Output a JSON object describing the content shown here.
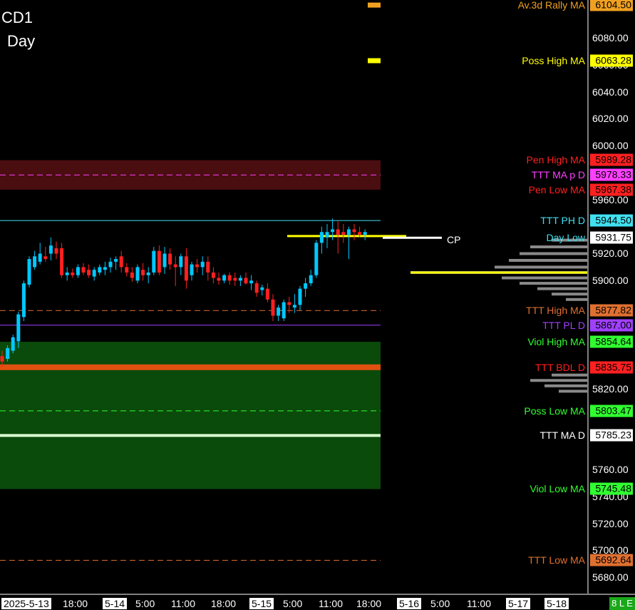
{
  "header": {
    "symbol": "CD1",
    "period": "Day"
  },
  "status_badge": "8 L E",
  "cp_label": "CP",
  "chart_data": {
    "type": "candlestick",
    "ylim": [
      5668,
      6108
    ],
    "y_ticks": [
      {
        "value": 6080,
        "label": "6080.00"
      },
      {
        "value": 6060,
        "label": "6060.00"
      },
      {
        "value": 6040,
        "label": "6040.00"
      },
      {
        "value": 6020,
        "label": "6020.00"
      },
      {
        "value": 6000,
        "label": "6000.00"
      },
      {
        "value": 5960,
        "label": "5960.00"
      },
      {
        "value": 5920,
        "label": "5920.00"
      },
      {
        "value": 5900,
        "label": "5900.00"
      },
      {
        "value": 5820,
        "label": "5820.00"
      },
      {
        "value": 5760,
        "label": "5760.00"
      },
      {
        "value": 5740,
        "label": "5740.00"
      },
      {
        "value": 5720,
        "label": "5720.00"
      },
      {
        "value": 5700,
        "label": "5700.00"
      },
      {
        "value": 5680,
        "label": "5680.00"
      }
    ],
    "x_ticks": [
      {
        "label": "2025-5-13",
        "boxed": true
      },
      {
        "label": "18:00",
        "boxed": false
      },
      {
        "label": "5-14",
        "boxed": true
      },
      {
        "label": "5:00",
        "boxed": false
      },
      {
        "label": "11:00",
        "boxed": false
      },
      {
        "label": "18:00",
        "boxed": false
      },
      {
        "label": "5-15",
        "boxed": true
      },
      {
        "label": "5:00",
        "boxed": false
      },
      {
        "label": "11:00",
        "boxed": false
      },
      {
        "label": "18:00",
        "boxed": false
      },
      {
        "label": "5-16",
        "boxed": true
      },
      {
        "label": "5:00",
        "boxed": false
      },
      {
        "label": "11:00",
        "boxed": false
      },
      {
        "label": "5-17",
        "boxed": true
      },
      {
        "label": "5-18",
        "boxed": true
      }
    ],
    "zones": [
      {
        "from": 5967.38,
        "to": 5989.28,
        "color": "#4a0d10"
      },
      {
        "from": 5745.48,
        "to": 5854.64,
        "color": "#0a4a0a"
      }
    ],
    "levels": [
      {
        "label": "Av.3d Rally MA",
        "price": "6104.50",
        "value": 6104.5,
        "color": "#f0a020",
        "bg": "#f0a020",
        "fg": "#000",
        "line": "marker"
      },
      {
        "label": "Poss High MA",
        "price": "6063.28",
        "value": 6063.28,
        "color": "#ffff00",
        "bg": "#ffff00",
        "fg": "#000",
        "line": "marker"
      },
      {
        "label": "Pen High MA",
        "price": "5989.28",
        "value": 5989.28,
        "color": "#ff2020",
        "bg": "#ff2020",
        "fg": "#000",
        "line": "none"
      },
      {
        "label": "TTT MA p D",
        "price": "5978.33",
        "value": 5978.33,
        "color": "#ff40ff",
        "bg": "#ff40ff",
        "fg": "#000",
        "line": "dash"
      },
      {
        "label": "Pen Low MA",
        "price": "5967.38",
        "value": 5967.38,
        "color": "#ff2020",
        "bg": "#ff2020",
        "fg": "#000",
        "line": "none"
      },
      {
        "label": "TTT PH D",
        "price": "5944.50",
        "value": 5944.5,
        "color": "#40e0f0",
        "bg": "#40e0f0",
        "fg": "#000",
        "line": "solid"
      },
      {
        "label": "Day Low",
        "price": "5931.75",
        "value": 5931.75,
        "color": "#40e0f0",
        "bg": "#ffffff",
        "fg": "#000",
        "line": "none"
      },
      {
        "label": "TTT High MA",
        "price": "5877.82",
        "value": 5877.82,
        "color": "#e07030",
        "bg": "#e07030",
        "fg": "#000",
        "line": "dash"
      },
      {
        "label": "TTT PL D",
        "price": "5867.00",
        "value": 5867.0,
        "color": "#a040ff",
        "bg": "#a040ff",
        "fg": "#000",
        "line": "solid"
      },
      {
        "label": "Viol High MA",
        "price": "5854.64",
        "value": 5854.64,
        "color": "#30ff30",
        "bg": "#30ff30",
        "fg": "#000",
        "line": "none"
      },
      {
        "label": "TTT BDL D",
        "price": "5835.75",
        "value": 5835.75,
        "color": "#ff2020",
        "bg": "#ff2020",
        "fg": "#000",
        "line": "thick"
      },
      {
        "label": "Poss Low MA",
        "price": "5803.47",
        "value": 5803.47,
        "color": "#30ff30",
        "bg": "#30ff30",
        "fg": "#000",
        "line": "dash"
      },
      {
        "label": "TTT MA D",
        "price": "5785.23",
        "value": 5785.23,
        "color": "#ffffff",
        "bg": "#ffffff",
        "fg": "#000",
        "line": "thickwhite"
      },
      {
        "label": "Viol Low MA",
        "price": "5745.48",
        "value": 5745.48,
        "color": "#30ff30",
        "bg": "#30ff30",
        "fg": "#000",
        "line": "none"
      },
      {
        "label": "TTT Low MA",
        "price": "5692.64",
        "value": 5692.64,
        "color": "#e07030",
        "bg": "#e07030",
        "fg": "#000",
        "line": "dash"
      }
    ],
    "candles": [
      {
        "o": 5844,
        "h": 5848,
        "l": 5836,
        "c": 5840
      },
      {
        "o": 5842,
        "h": 5852,
        "l": 5840,
        "c": 5850
      },
      {
        "o": 5848,
        "h": 5860,
        "l": 5846,
        "c": 5858
      },
      {
        "o": 5855,
        "h": 5877,
        "l": 5850,
        "c": 5875
      },
      {
        "o": 5873,
        "h": 5900,
        "l": 5870,
        "c": 5898
      },
      {
        "o": 5897,
        "h": 5918,
        "l": 5895,
        "c": 5916
      },
      {
        "o": 5910,
        "h": 5922,
        "l": 5908,
        "c": 5918
      },
      {
        "o": 5914,
        "h": 5928,
        "l": 5912,
        "c": 5920
      },
      {
        "o": 5918,
        "h": 5925,
        "l": 5914,
        "c": 5916
      },
      {
        "o": 5920,
        "h": 5932,
        "l": 5915,
        "c": 5926
      },
      {
        "o": 5924,
        "h": 5929,
        "l": 5916,
        "c": 5920
      },
      {
        "o": 5924,
        "h": 5928,
        "l": 5902,
        "c": 5904
      },
      {
        "o": 5904,
        "h": 5910,
        "l": 5900,
        "c": 5906
      },
      {
        "o": 5906,
        "h": 5909,
        "l": 5902,
        "c": 5904
      },
      {
        "o": 5904,
        "h": 5912,
        "l": 5902,
        "c": 5910
      },
      {
        "o": 5910,
        "h": 5913,
        "l": 5904,
        "c": 5906
      },
      {
        "o": 5908,
        "h": 5912,
        "l": 5902,
        "c": 5904
      },
      {
        "o": 5903,
        "h": 5910,
        "l": 5900,
        "c": 5908
      },
      {
        "o": 5906,
        "h": 5912,
        "l": 5904,
        "c": 5910
      },
      {
        "o": 5908,
        "h": 5914,
        "l": 5904,
        "c": 5910
      },
      {
        "o": 5910,
        "h": 5917,
        "l": 5906,
        "c": 5914
      },
      {
        "o": 5914,
        "h": 5918,
        "l": 5908,
        "c": 5916
      },
      {
        "o": 5918,
        "h": 5922,
        "l": 5906,
        "c": 5910
      },
      {
        "o": 5910,
        "h": 5913,
        "l": 5903,
        "c": 5906
      },
      {
        "o": 5906,
        "h": 5910,
        "l": 5899,
        "c": 5902
      },
      {
        "o": 5900,
        "h": 5912,
        "l": 5898,
        "c": 5910
      },
      {
        "o": 5908,
        "h": 5913,
        "l": 5900,
        "c": 5904
      },
      {
        "o": 5904,
        "h": 5910,
        "l": 5898,
        "c": 5906
      },
      {
        "o": 5906,
        "h": 5925,
        "l": 5904,
        "c": 5922
      },
      {
        "o": 5922,
        "h": 5926,
        "l": 5904,
        "c": 5906
      },
      {
        "o": 5910,
        "h": 5925,
        "l": 5905,
        "c": 5920
      },
      {
        "o": 5920,
        "h": 5924,
        "l": 5908,
        "c": 5912
      },
      {
        "o": 5912,
        "h": 5918,
        "l": 5896,
        "c": 5910
      },
      {
        "o": 5910,
        "h": 5920,
        "l": 5904,
        "c": 5918
      },
      {
        "o": 5918,
        "h": 5924,
        "l": 5894,
        "c": 5900
      },
      {
        "o": 5904,
        "h": 5914,
        "l": 5900,
        "c": 5912
      },
      {
        "o": 5912,
        "h": 5916,
        "l": 5906,
        "c": 5910
      },
      {
        "o": 5910,
        "h": 5918,
        "l": 5904,
        "c": 5914
      },
      {
        "o": 5914,
        "h": 5918,
        "l": 5900,
        "c": 5906
      },
      {
        "o": 5906,
        "h": 5910,
        "l": 5898,
        "c": 5902
      },
      {
        "o": 5902,
        "h": 5906,
        "l": 5897,
        "c": 5900
      },
      {
        "o": 5900,
        "h": 5905,
        "l": 5898,
        "c": 5904
      },
      {
        "o": 5904,
        "h": 5906,
        "l": 5897,
        "c": 5900
      },
      {
        "o": 5902,
        "h": 5906,
        "l": 5896,
        "c": 5900
      },
      {
        "o": 5900,
        "h": 5904,
        "l": 5896,
        "c": 5902
      },
      {
        "o": 5902,
        "h": 5906,
        "l": 5897,
        "c": 5898
      },
      {
        "o": 5898,
        "h": 5904,
        "l": 5893,
        "c": 5900
      },
      {
        "o": 5898,
        "h": 5900,
        "l": 5888,
        "c": 5891
      },
      {
        "o": 5893,
        "h": 5897,
        "l": 5889,
        "c": 5895
      },
      {
        "o": 5894,
        "h": 5898,
        "l": 5884,
        "c": 5886
      },
      {
        "o": 5886,
        "h": 5890,
        "l": 5870,
        "c": 5874
      },
      {
        "o": 5874,
        "h": 5882,
        "l": 5870,
        "c": 5880
      },
      {
        "o": 5872,
        "h": 5886,
        "l": 5870,
        "c": 5884
      },
      {
        "o": 5884,
        "h": 5888,
        "l": 5876,
        "c": 5882
      },
      {
        "o": 5880,
        "h": 5890,
        "l": 5876,
        "c": 5882
      },
      {
        "o": 5882,
        "h": 5896,
        "l": 5878,
        "c": 5894
      },
      {
        "o": 5894,
        "h": 5902,
        "l": 5888,
        "c": 5898
      },
      {
        "o": 5898,
        "h": 5908,
        "l": 5896,
        "c": 5904
      },
      {
        "o": 5904,
        "h": 5930,
        "l": 5902,
        "c": 5928
      },
      {
        "o": 5928,
        "h": 5940,
        "l": 5920,
        "c": 5936
      },
      {
        "o": 5932,
        "h": 5942,
        "l": 5924,
        "c": 5936
      },
      {
        "o": 5936,
        "h": 5946,
        "l": 5930,
        "c": 5938
      },
      {
        "o": 5938,
        "h": 5944,
        "l": 5920,
        "c": 5934
      },
      {
        "o": 5936,
        "h": 5942,
        "l": 5928,
        "c": 5934
      },
      {
        "o": 5934,
        "h": 5940,
        "l": 5916,
        "c": 5938
      },
      {
        "o": 5938,
        "h": 5942,
        "l": 5930,
        "c": 5936
      },
      {
        "o": 5936,
        "h": 5940,
        "l": 5932,
        "c": 5934
      },
      {
        "o": 5934,
        "h": 5938,
        "l": 5930,
        "c": 5936
      }
    ]
  }
}
